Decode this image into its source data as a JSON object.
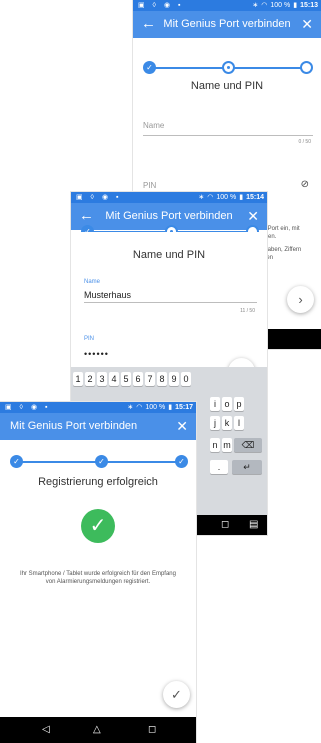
{
  "screens": {
    "back": {
      "status": {
        "battery": "100 %",
        "time": "15:13"
      },
      "app_title": "Mit Genius Port verbinden",
      "step_title": "Name und PIN",
      "name_label": "Name",
      "name_counter": "0 / 50",
      "pin_label": "PIN",
      "hint_line1": "s Port ein, mit",
      "hint_line2": "nten.",
      "hint_line3": "staben, Ziffern",
      "hint_line4": "hen"
    },
    "middle": {
      "status": {
        "battery": "100 %",
        "time": "15:14"
      },
      "app_title": "Mit Genius Port verbinden",
      "step_title": "Name und PIN",
      "name_label": "Name",
      "name_value": "Musterhaus",
      "name_counter": "11 / 50",
      "pin_label": "PIN",
      "pin_value": "••••••",
      "keyboard_row1": [
        "1",
        "2",
        "3",
        "4",
        "5",
        "6",
        "7",
        "8",
        "9",
        "0"
      ],
      "keyboard_row2_visible": [
        "i",
        "o",
        "p"
      ],
      "keyboard_row3_visible": [
        "j",
        "k",
        "l"
      ],
      "keyboard_row4_visible": [
        "n",
        "m"
      ]
    },
    "front": {
      "status": {
        "battery": "100 %",
        "time": "15:17"
      },
      "app_title": "Mit Genius Port verbinden",
      "step_title": "Registrierung erfolgreich",
      "message": "Ihr Smartphone / Tablet wurde erfolgreich für den Empfang von Alarmierungsmeldungen registriert."
    }
  },
  "icons": {
    "back": "arrow-left-icon",
    "close": "close-icon",
    "visibility": "eye-off-icon",
    "next": "chevron-right-icon",
    "done": "check-icon"
  },
  "colors": {
    "app_bar": "#4a90e8",
    "status_bar": "#2c7be0",
    "success": "#3dbb5c",
    "keyboard": "#d7dade"
  }
}
